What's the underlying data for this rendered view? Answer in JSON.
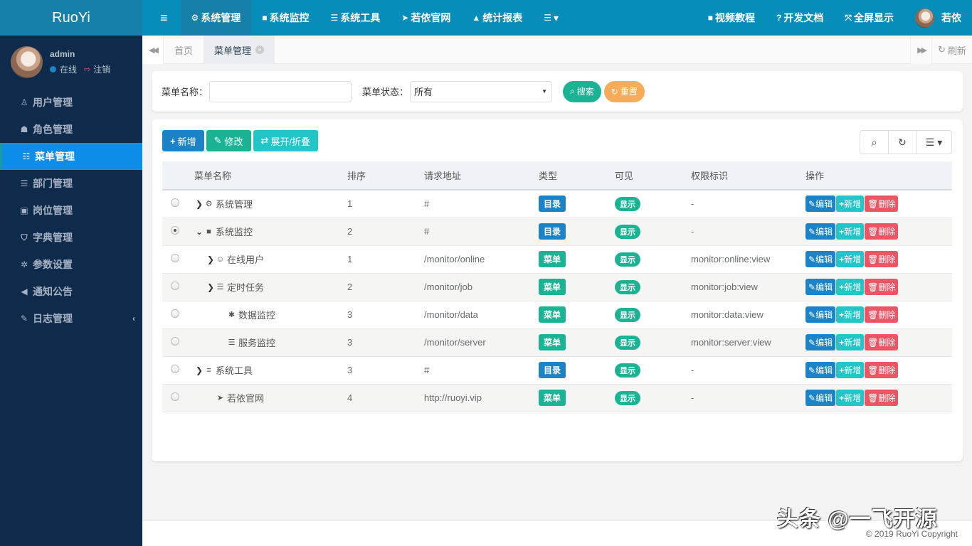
{
  "app": {
    "logo": "RuoYi"
  },
  "user": {
    "name": "admin",
    "status": "在线",
    "logout": "注销",
    "display_name": "若依"
  },
  "sidebar": {
    "items": [
      {
        "label": "用户管理",
        "icon": "user-icon",
        "glyph": "♙"
      },
      {
        "label": "角色管理",
        "icon": "user-secret-icon",
        "glyph": "☗"
      },
      {
        "label": "菜单管理",
        "icon": "th-list-icon",
        "glyph": "☷",
        "active": true
      },
      {
        "label": "部门管理",
        "icon": "outdent-icon",
        "glyph": "☰"
      },
      {
        "label": "岗位管理",
        "icon": "id-card-icon",
        "glyph": "▣"
      },
      {
        "label": "字典管理",
        "icon": "bookmark-icon",
        "glyph": "⛉"
      },
      {
        "label": "参数设置",
        "icon": "sun-icon",
        "glyph": "✲"
      },
      {
        "label": "通知公告",
        "icon": "bullhorn-icon",
        "glyph": "◀"
      },
      {
        "label": "日志管理",
        "icon": "edit-icon",
        "glyph": "✎",
        "arrow": "‹"
      }
    ]
  },
  "topbar": {
    "toggle": "≡",
    "items": [
      {
        "label": "系统管理",
        "glyph": "⚙",
        "icon": "gear-icon",
        "active": true
      },
      {
        "label": "系统监控",
        "glyph": "■",
        "icon": "video-camera-icon"
      },
      {
        "label": "系统工具",
        "glyph": "☰",
        "icon": "bars-icon"
      },
      {
        "label": "若依官网",
        "glyph": "➤",
        "icon": "location-arrow-icon"
      },
      {
        "label": "统计报表",
        "glyph": "▲",
        "icon": "area-chart-icon"
      },
      {
        "label": "▾",
        "glyph": "☰",
        "icon": "more-menu-icon"
      }
    ],
    "right": [
      {
        "label": "视频教程",
        "glyph": "■",
        "icon": "video-camera-icon"
      },
      {
        "label": "开发文档",
        "glyph": "?",
        "icon": "question-circle-icon"
      },
      {
        "label": "全屏显示",
        "glyph": "⤧",
        "icon": "fullscreen-icon"
      }
    ]
  },
  "tabs": {
    "items": [
      {
        "label": "首页"
      },
      {
        "label": "菜单管理",
        "active": true,
        "close": "×"
      }
    ],
    "left_nav": "◀◀",
    "right_nav": "▶▶",
    "refresh": "刷新"
  },
  "search": {
    "menu_name_label": "菜单名称：",
    "menu_name_value": "",
    "status_label": "菜单状态：",
    "status_value": "所有",
    "search_button": "搜索",
    "reset_button": "重置",
    "search_color": "#1ab394",
    "reset_color": "#f8ac59"
  },
  "toolbar": {
    "add": "新增",
    "edit": "修改",
    "expand": "展开/折叠"
  },
  "table": {
    "columns": [
      "",
      "菜单名称",
      "排序",
      "请求地址",
      "类型",
      "可见",
      "权限标识",
      "操作"
    ],
    "actions": {
      "edit": "编辑",
      "add": "新增",
      "delete": "删除"
    },
    "rows": [
      {
        "name": "系统管理",
        "icon": "gear-icon",
        "glyph": "⚙",
        "expander": "›",
        "level": 0,
        "order": "1",
        "url": "#",
        "type": "目录",
        "visible": "显示",
        "perms": "-",
        "selected": false
      },
      {
        "name": "系统监控",
        "icon": "video-camera-icon",
        "glyph": "■",
        "expander": "⌄",
        "level": 0,
        "order": "2",
        "url": "#",
        "type": "目录",
        "visible": "显示",
        "perms": "-",
        "selected": true
      },
      {
        "name": "在线用户",
        "icon": "user-circle-icon",
        "glyph": "☺",
        "expander": "›",
        "level": 1,
        "order": "1",
        "url": "/monitor/online",
        "type": "菜单",
        "visible": "显示",
        "perms": "monitor:online:view",
        "selected": false
      },
      {
        "name": "定时任务",
        "icon": "tasks-icon",
        "glyph": "☰",
        "expander": "›",
        "level": 1,
        "order": "2",
        "url": "/monitor/job",
        "type": "菜单",
        "visible": "显示",
        "perms": "monitor:job:view",
        "selected": false
      },
      {
        "name": "数据监控",
        "icon": "bug-icon",
        "glyph": "✱",
        "expander": "",
        "level": 2,
        "order": "3",
        "url": "/monitor/data",
        "type": "菜单",
        "visible": "显示",
        "perms": "monitor:data:view",
        "selected": false
      },
      {
        "name": "服务监控",
        "icon": "server-icon",
        "glyph": "☰",
        "expander": "",
        "level": 2,
        "order": "3",
        "url": "/monitor/server",
        "type": "菜单",
        "visible": "显示",
        "perms": "monitor:server:view",
        "selected": false
      },
      {
        "name": "系统工具",
        "icon": "bars-icon",
        "glyph": "≡",
        "expander": "›",
        "level": 0,
        "order": "3",
        "url": "#",
        "type": "目录",
        "visible": "显示",
        "perms": "-",
        "selected": false
      },
      {
        "name": "若依官网",
        "icon": "location-arrow-icon",
        "glyph": "➤",
        "expander": "",
        "level": 1,
        "order": "4",
        "url": "http://ruoyi.vip",
        "type": "菜单",
        "visible": "显示",
        "perms": "-",
        "selected": false
      }
    ]
  },
  "footer": {
    "copyright": "© 2019 RuoYi Copyright"
  },
  "watermark": "头条 @一飞开源"
}
